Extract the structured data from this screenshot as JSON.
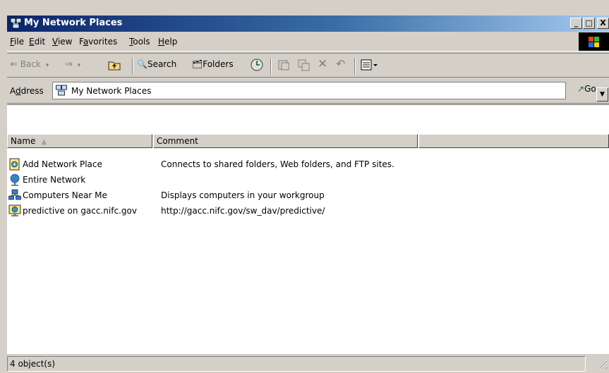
{
  "window": {
    "title": "My Network Places",
    "caption_buttons": [
      "_",
      "□",
      "X"
    ]
  },
  "menu": {
    "file": {
      "accel": "F",
      "rest": "ile"
    },
    "edit": {
      "accel": "E",
      "rest": "dit"
    },
    "view": {
      "accel": "V",
      "rest": "iew"
    },
    "favorites": {
      "pre": "F",
      "accel": "a",
      "rest": "vorites"
    },
    "tools": {
      "accel": "T",
      "rest": "ools"
    },
    "help": {
      "accel": "H",
      "rest": "elp"
    }
  },
  "toolbar": {
    "back_label": "Back",
    "search_label": "Search",
    "folders_label": "Folders"
  },
  "address": {
    "label_pre": "A",
    "label_accel": "d",
    "label_rest": "dress",
    "value": "My Network Places",
    "go_label": "Go"
  },
  "columns": {
    "name": "Name",
    "comment": "Comment"
  },
  "items": [
    {
      "name": "Add Network Place",
      "comment": "Connects to shared folders, Web folders, and FTP sites.",
      "icon": "add-network-place-icon"
    },
    {
      "name": "Entire Network",
      "comment": "",
      "icon": "entire-network-icon"
    },
    {
      "name": "Computers Near Me",
      "comment": "Displays computers in your workgroup",
      "icon": "computers-near-me-icon"
    },
    {
      "name": "predictive on gacc.nifc.gov",
      "comment": "http://gacc.nifc.gov/sw_dav/predictive/",
      "icon": "web-folder-icon"
    }
  ],
  "status": {
    "text": "4 object(s)"
  },
  "colors": {
    "title_start": "#0a246a",
    "title_end": "#a6caf0",
    "chrome": "#d4d0c8"
  }
}
